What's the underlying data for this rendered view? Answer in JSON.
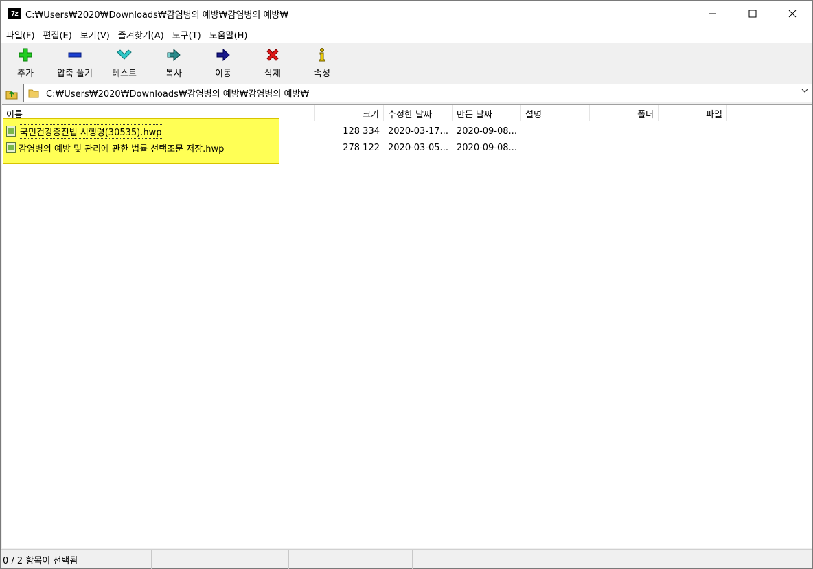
{
  "window": {
    "app_icon_text": "7z",
    "title": "C:₩Users₩2020₩Downloads₩감염병의 예방₩감염병의 예방₩",
    "controls": {
      "minimize": "—",
      "maximize": "☐",
      "close": "✕"
    }
  },
  "menu": [
    "파일(F)",
    "편집(E)",
    "보기(V)",
    "즐겨찾기(A)",
    "도구(T)",
    "도움말(H)"
  ],
  "toolbar": [
    {
      "label": "추가",
      "icon": "plus-icon",
      "color": "#22cc22"
    },
    {
      "label": "압축 풀기",
      "icon": "minus-icon",
      "color": "#1a3fd1"
    },
    {
      "label": "테스트",
      "icon": "check-icon",
      "color": "#30c8c8"
    },
    {
      "label": "복사",
      "icon": "double-arrow-icon",
      "color": "#2a8a8a"
    },
    {
      "label": "이동",
      "icon": "arrow-right-icon",
      "color": "#1a1a8a"
    },
    {
      "label": "삭제",
      "icon": "x-icon",
      "color": "#e01818"
    },
    {
      "label": "속성",
      "icon": "info-icon",
      "color": "#c8a800"
    }
  ],
  "address": {
    "path": "C:₩Users₩2020₩Downloads₩감염병의 예방₩감염병의 예방₩"
  },
  "columns": {
    "name": "이름",
    "size": "크기",
    "modified": "수정한 날짜",
    "created": "만든 날짜",
    "comment": "설명",
    "folders": "폴더",
    "files": "파일"
  },
  "files": [
    {
      "name": "국민건강증진법 시행령(30535).hwp",
      "size": "128 334",
      "modified": "2020-03-17...",
      "created": "2020-09-08..."
    },
    {
      "name": "감염병의 예방 및 관리에 관한 법률 선택조문 저장.hwp",
      "size": "278 122",
      "modified": "2020-03-05...",
      "created": "2020-09-08..."
    }
  ],
  "status": {
    "selection": "0 / 2 항목이 선택됨"
  },
  "colors": {
    "highlight": "#ffff55"
  }
}
